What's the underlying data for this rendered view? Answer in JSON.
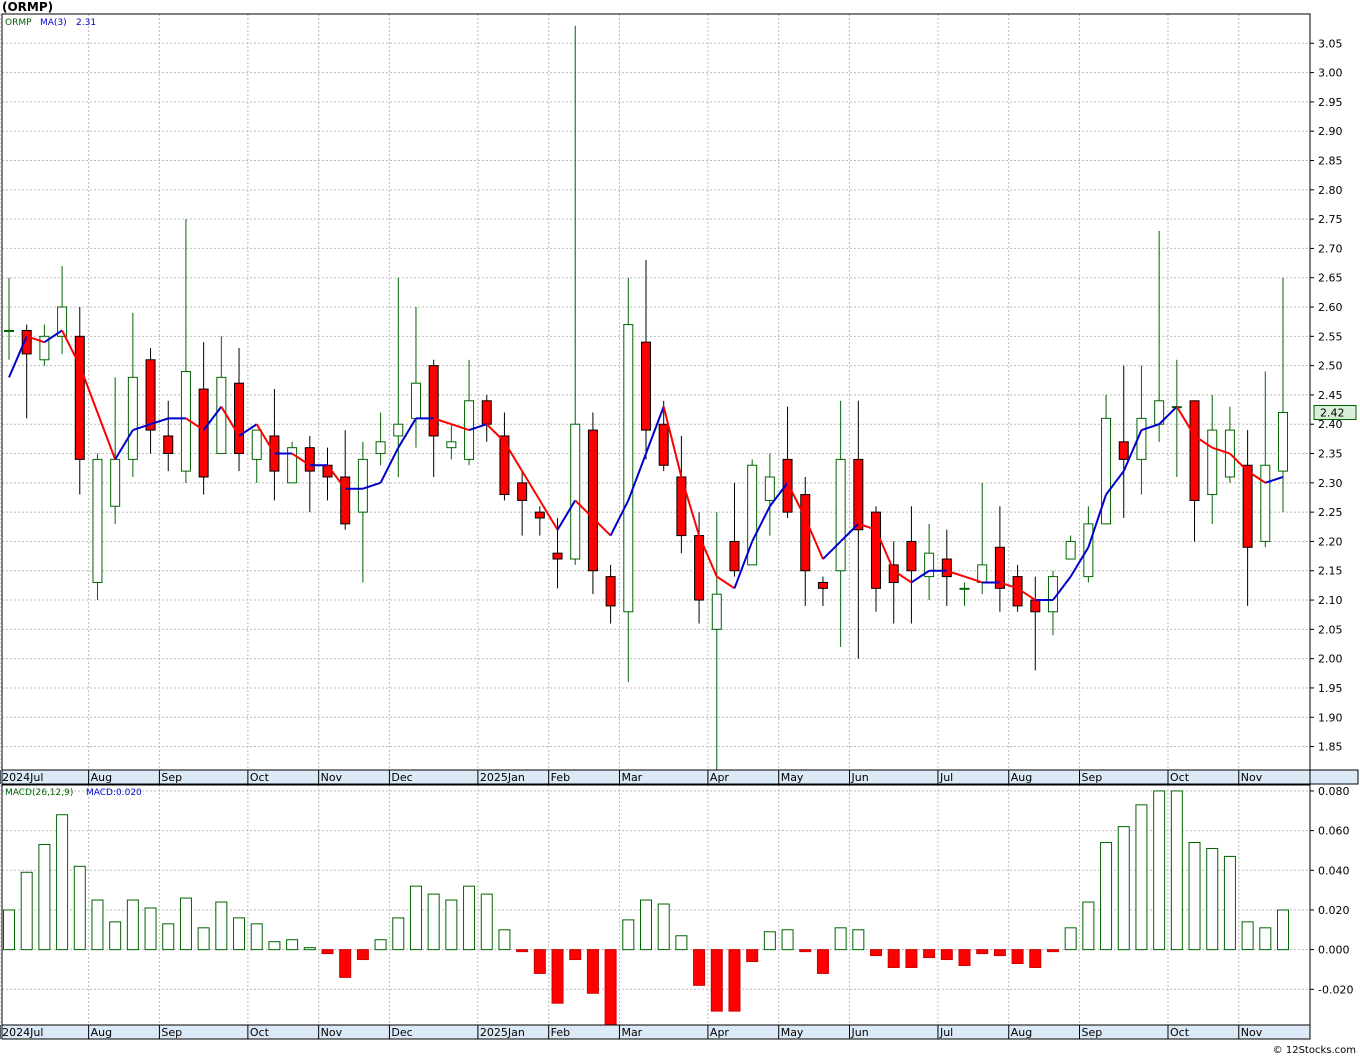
{
  "title": "(ORMP)",
  "credit": "© 12Stocks.com",
  "colors": {
    "up": "#006400",
    "down": "#ff0000",
    "ma_up": "#0000cc",
    "ma_down": "#ff0000",
    "grid": "#bbbbbb",
    "axis": "#000000"
  },
  "chart_data": [
    {
      "type": "candlestick",
      "legend": {
        "symbol": "ORMP",
        "ma_label": "MA(3)",
        "ma_value": "2.31"
      },
      "last_price_label": "2.42",
      "ylim": [
        1.81,
        3.1
      ],
      "y_ticks": [
        1.85,
        1.9,
        1.95,
        2.0,
        2.05,
        2.1,
        2.15,
        2.2,
        2.25,
        2.3,
        2.35,
        2.4,
        2.45,
        2.5,
        2.55,
        2.6,
        2.65,
        2.7,
        2.75,
        2.8,
        2.85,
        2.9,
        2.95,
        3.0,
        3.05
      ],
      "x_labels": [
        "2024Jul",
        "Aug",
        "Sep",
        "Oct",
        "Nov",
        "Dec",
        "2025Jan",
        "Feb",
        "Mar",
        "Apr",
        "May",
        "Jun",
        "Jul",
        "Aug",
        "Sep",
        "Oct",
        "Nov"
      ],
      "x_label_index": [
        0,
        5,
        9,
        14,
        18,
        22,
        27,
        31,
        35,
        40,
        44,
        48,
        53,
        57,
        61,
        66,
        70
      ],
      "candles": [
        {
          "o": 2.56,
          "h": 2.65,
          "l": 2.51,
          "c": 2.56
        },
        {
          "o": 2.56,
          "h": 2.57,
          "l": 2.41,
          "c": 2.52
        },
        {
          "o": 2.51,
          "h": 2.57,
          "l": 2.5,
          "c": 2.55
        },
        {
          "o": 2.55,
          "h": 2.67,
          "l": 2.52,
          "c": 2.6
        },
        {
          "o": 2.55,
          "h": 2.6,
          "l": 2.28,
          "c": 2.34
        },
        {
          "o": 2.13,
          "h": 2.35,
          "l": 2.1,
          "c": 2.34
        },
        {
          "o": 2.26,
          "h": 2.48,
          "l": 2.23,
          "c": 2.34
        },
        {
          "o": 2.34,
          "h": 2.59,
          "l": 2.31,
          "c": 2.48
        },
        {
          "o": 2.51,
          "h": 2.53,
          "l": 2.35,
          "c": 2.39
        },
        {
          "o": 2.38,
          "h": 2.44,
          "l": 2.32,
          "c": 2.35
        },
        {
          "o": 2.32,
          "h": 2.75,
          "l": 2.3,
          "c": 2.49
        },
        {
          "o": 2.46,
          "h": 2.54,
          "l": 2.28,
          "c": 2.31
        },
        {
          "o": 2.35,
          "h": 2.55,
          "l": 2.35,
          "c": 2.48
        },
        {
          "o": 2.47,
          "h": 2.53,
          "l": 2.32,
          "c": 2.35
        },
        {
          "o": 2.34,
          "h": 2.38,
          "l": 2.3,
          "c": 2.39
        },
        {
          "o": 2.38,
          "h": 2.46,
          "l": 2.27,
          "c": 2.32
        },
        {
          "o": 2.3,
          "h": 2.37,
          "l": 2.3,
          "c": 2.36
        },
        {
          "o": 2.36,
          "h": 2.38,
          "l": 2.25,
          "c": 2.32
        },
        {
          "o": 2.33,
          "h": 2.36,
          "l": 2.27,
          "c": 2.31
        },
        {
          "o": 2.31,
          "h": 2.39,
          "l": 2.22,
          "c": 2.23
        },
        {
          "o": 2.25,
          "h": 2.37,
          "l": 2.13,
          "c": 2.34
        },
        {
          "o": 2.35,
          "h": 2.42,
          "l": 2.33,
          "c": 2.37
        },
        {
          "o": 2.38,
          "h": 2.65,
          "l": 2.31,
          "c": 2.4
        },
        {
          "o": 2.41,
          "h": 2.6,
          "l": 2.36,
          "c": 2.47
        },
        {
          "o": 2.5,
          "h": 2.51,
          "l": 2.31,
          "c": 2.38
        },
        {
          "o": 2.36,
          "h": 2.4,
          "l": 2.34,
          "c": 2.37
        },
        {
          "o": 2.34,
          "h": 2.51,
          "l": 2.33,
          "c": 2.44
        },
        {
          "o": 2.44,
          "h": 2.45,
          "l": 2.37,
          "c": 2.4
        },
        {
          "o": 2.38,
          "h": 2.42,
          "l": 2.27,
          "c": 2.28
        },
        {
          "o": 2.3,
          "h": 2.32,
          "l": 2.21,
          "c": 2.27
        },
        {
          "o": 2.25,
          "h": 2.26,
          "l": 2.21,
          "c": 2.24
        },
        {
          "o": 2.18,
          "h": 2.24,
          "l": 2.12,
          "c": 2.17
        },
        {
          "o": 2.17,
          "h": 3.08,
          "l": 2.16,
          "c": 2.4
        },
        {
          "o": 2.39,
          "h": 2.42,
          "l": 2.11,
          "c": 2.15
        },
        {
          "o": 2.14,
          "h": 2.16,
          "l": 2.06,
          "c": 2.09
        },
        {
          "o": 2.08,
          "h": 2.65,
          "l": 1.96,
          "c": 2.57
        },
        {
          "o": 2.54,
          "h": 2.68,
          "l": 2.34,
          "c": 2.39
        },
        {
          "o": 2.4,
          "h": 2.44,
          "l": 2.32,
          "c": 2.33
        },
        {
          "o": 2.31,
          "h": 2.38,
          "l": 2.18,
          "c": 2.21
        },
        {
          "o": 2.21,
          "h": 2.25,
          "l": 2.06,
          "c": 2.1
        },
        {
          "o": 2.05,
          "h": 2.25,
          "l": 1.8,
          "c": 2.11
        },
        {
          "o": 2.2,
          "h": 2.3,
          "l": 2.14,
          "c": 2.15
        },
        {
          "o": 2.16,
          "h": 2.34,
          "l": 2.16,
          "c": 2.33
        },
        {
          "o": 2.27,
          "h": 2.35,
          "l": 2.21,
          "c": 2.31
        },
        {
          "o": 2.34,
          "h": 2.43,
          "l": 2.24,
          "c": 2.25
        },
        {
          "o": 2.28,
          "h": 2.31,
          "l": 2.09,
          "c": 2.15
        },
        {
          "o": 2.13,
          "h": 2.14,
          "l": 2.09,
          "c": 2.12
        },
        {
          "o": 2.15,
          "h": 2.44,
          "l": 2.02,
          "c": 2.34
        },
        {
          "o": 2.34,
          "h": 2.44,
          "l": 2.0,
          "c": 2.22
        },
        {
          "o": 2.25,
          "h": 2.26,
          "l": 2.08,
          "c": 2.12
        },
        {
          "o": 2.16,
          "h": 2.2,
          "l": 2.06,
          "c": 2.13
        },
        {
          "o": 2.2,
          "h": 2.26,
          "l": 2.06,
          "c": 2.15
        },
        {
          "o": 2.14,
          "h": 2.23,
          "l": 2.1,
          "c": 2.18
        },
        {
          "o": 2.17,
          "h": 2.22,
          "l": 2.09,
          "c": 2.14
        },
        {
          "o": 2.12,
          "h": 2.13,
          "l": 2.09,
          "c": 2.12
        },
        {
          "o": 2.13,
          "h": 2.3,
          "l": 2.11,
          "c": 2.16
        },
        {
          "o": 2.19,
          "h": 2.26,
          "l": 2.08,
          "c": 2.12
        },
        {
          "o": 2.14,
          "h": 2.16,
          "l": 2.08,
          "c": 2.09
        },
        {
          "o": 2.1,
          "h": 2.14,
          "l": 1.98,
          "c": 2.08
        },
        {
          "o": 2.08,
          "h": 2.15,
          "l": 2.04,
          "c": 2.14
        },
        {
          "o": 2.17,
          "h": 2.21,
          "l": 2.17,
          "c": 2.2
        },
        {
          "o": 2.14,
          "h": 2.26,
          "l": 2.13,
          "c": 2.23
        },
        {
          "o": 2.23,
          "h": 2.45,
          "l": 2.23,
          "c": 2.41
        },
        {
          "o": 2.37,
          "h": 2.5,
          "l": 2.24,
          "c": 2.34
        },
        {
          "o": 2.34,
          "h": 2.5,
          "l": 2.28,
          "c": 2.41
        },
        {
          "o": 2.4,
          "h": 2.73,
          "l": 2.37,
          "c": 2.44
        },
        {
          "o": 2.43,
          "h": 2.51,
          "l": 2.31,
          "c": 2.43
        },
        {
          "o": 2.44,
          "h": 2.44,
          "l": 2.2,
          "c": 2.27
        },
        {
          "o": 2.28,
          "h": 2.45,
          "l": 2.23,
          "c": 2.39
        },
        {
          "o": 2.31,
          "h": 2.43,
          "l": 2.3,
          "c": 2.39
        },
        {
          "o": 2.33,
          "h": 2.39,
          "l": 2.09,
          "c": 2.19
        },
        {
          "o": 2.2,
          "h": 2.49,
          "l": 2.19,
          "c": 2.33
        },
        {
          "o": 2.32,
          "h": 2.65,
          "l": 2.25,
          "c": 2.42
        }
      ],
      "ma": [
        2.48,
        2.55,
        2.54,
        2.56,
        2.5,
        2.42,
        2.34,
        2.39,
        2.4,
        2.41,
        2.41,
        2.39,
        2.43,
        2.38,
        2.4,
        2.35,
        2.35,
        2.33,
        2.33,
        2.29,
        2.29,
        2.3,
        2.36,
        2.41,
        2.41,
        2.4,
        2.39,
        2.4,
        2.37,
        2.32,
        2.27,
        2.22,
        2.27,
        2.24,
        2.21,
        2.27,
        2.35,
        2.43,
        2.31,
        2.21,
        2.14,
        2.12,
        2.2,
        2.26,
        2.3,
        2.24,
        2.17,
        2.2,
        2.23,
        2.22,
        2.15,
        2.13,
        2.15,
        2.15,
        2.14,
        2.13,
        2.13,
        2.12,
        2.1,
        2.1,
        2.14,
        2.19,
        2.28,
        2.32,
        2.39,
        2.4,
        2.43,
        2.38,
        2.36,
        2.35,
        2.32,
        2.3,
        2.31
      ]
    },
    {
      "type": "bar",
      "legend": {
        "label": "MACD(26,12,9)",
        "value_label": "MACD:0.020"
      },
      "ylim": [
        -0.038,
        0.083
      ],
      "y_ticks": [
        -0.02,
        0.0,
        0.02,
        0.04,
        0.06,
        0.08
      ],
      "y_tick_labels": [
        "-0.020",
        "0.000",
        "0.020",
        "0.040",
        "0.060",
        "0.080"
      ],
      "x_labels": [
        "2024Jul",
        "Aug",
        "Sep",
        "Oct",
        "Nov",
        "Dec",
        "2025Jan",
        "Feb",
        "Mar",
        "Apr",
        "May",
        "Jun",
        "Jul",
        "Aug",
        "Sep",
        "Oct",
        "Nov"
      ],
      "values": [
        0.02,
        0.039,
        0.053,
        0.068,
        0.042,
        0.025,
        0.014,
        0.025,
        0.021,
        0.013,
        0.026,
        0.011,
        0.024,
        0.016,
        0.013,
        0.004,
        0.005,
        0.001,
        -0.002,
        -0.014,
        -0.005,
        0.005,
        0.016,
        0.032,
        0.028,
        0.025,
        0.032,
        0.028,
        0.01,
        -0.001,
        -0.012,
        -0.027,
        -0.005,
        -0.022,
        -0.04,
        0.015,
        0.025,
        0.023,
        0.007,
        -0.018,
        -0.031,
        -0.031,
        -0.006,
        0.009,
        0.01,
        -0.001,
        -0.012,
        0.011,
        0.01,
        -0.003,
        -0.009,
        -0.009,
        -0.004,
        -0.005,
        -0.008,
        -0.002,
        -0.003,
        -0.007,
        -0.009,
        -0.001,
        0.011,
        0.024,
        0.054,
        0.062,
        0.073,
        0.08,
        0.08,
        0.054,
        0.051,
        0.047,
        0.014,
        0.011,
        0.02
      ]
    }
  ]
}
